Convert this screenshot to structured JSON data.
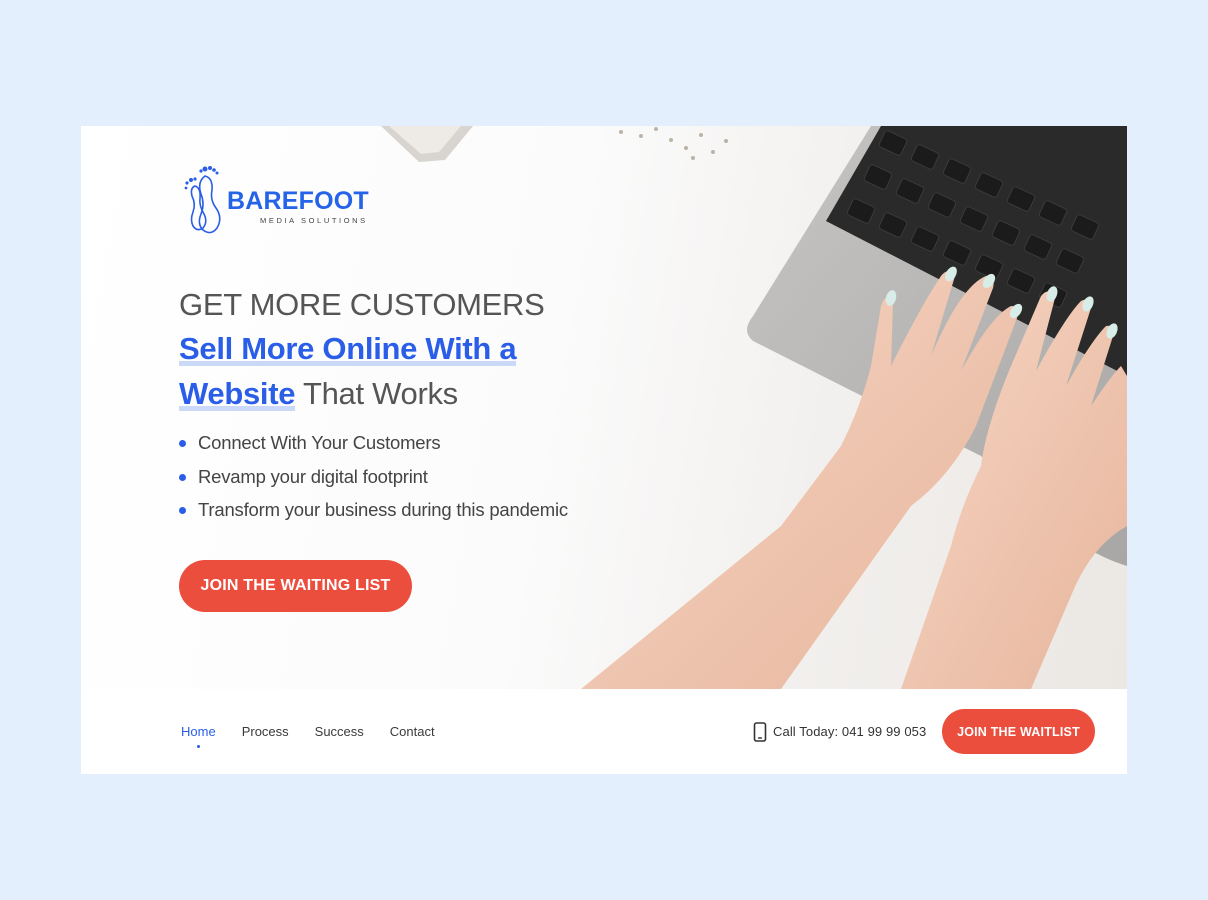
{
  "logo": {
    "word": "BAREFOOT",
    "sub": "MEDIA SOLUTIONS"
  },
  "hero": {
    "line1": "GET MORE CUSTOMERS",
    "line2_accent": "Sell More Online With a",
    "line3_accent": "Website",
    "line3_plain": " That Works",
    "bullets": [
      "Connect With Your Customers",
      "Revamp your digital footprint",
      "Transform your business during this pandemic"
    ],
    "cta_label": "JOIN THE WAITING LIST"
  },
  "nav": {
    "links": [
      "Home",
      "Process",
      "Success",
      "Contact"
    ],
    "active": "Home",
    "call_text": "Call Today: 041 99 99 053",
    "cta_label": "JOIN THE WAITLIST"
  },
  "colors": {
    "page_bg": "#e3effc",
    "accent_blue": "#2a5ee8",
    "cta_red": "#ec4e3e",
    "text_gray": "#555555"
  },
  "icons": {
    "phone": "phone-icon",
    "logo_mark": "footprints-icon"
  }
}
